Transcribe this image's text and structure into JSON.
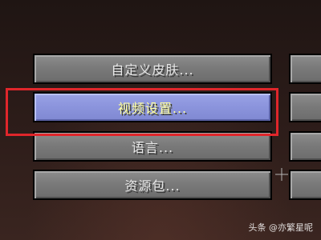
{
  "menu": {
    "buttons": [
      {
        "label": "自定义皮肤..."
      },
      {
        "label": "视频设置..."
      },
      {
        "label": "语言..."
      },
      {
        "label": "资源包..."
      }
    ],
    "selected_index": 1
  },
  "watermark": {
    "text": "头条 @亦繁星呢"
  },
  "colors": {
    "button": "#7a7a7a",
    "selected_button": "#8c95dd",
    "selected_text": "#ffffa0",
    "highlight": "#e0262b"
  }
}
